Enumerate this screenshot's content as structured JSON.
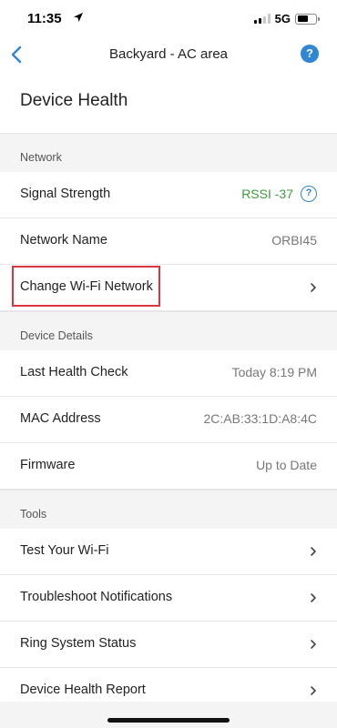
{
  "status_bar": {
    "time": "11:35",
    "network": "5G"
  },
  "nav": {
    "title": "Backyard - AC area",
    "help_glyph": "?"
  },
  "page_title": "Device Health",
  "sections": {
    "network": {
      "header": "Network",
      "signal_strength": {
        "label": "Signal Strength",
        "value": "RSSI -37"
      },
      "network_name": {
        "label": "Network Name",
        "value": "ORBI45"
      },
      "change_wifi": {
        "label": "Change Wi-Fi Network"
      }
    },
    "device_details": {
      "header": "Device Details",
      "last_health_check": {
        "label": "Last Health Check",
        "value": "Today 8:19 PM"
      },
      "mac_address": {
        "label": "MAC Address",
        "value": "2C:AB:33:1D:A8:4C"
      },
      "firmware": {
        "label": "Firmware",
        "value": "Up to Date"
      }
    },
    "tools": {
      "header": "Tools",
      "test_wifi": {
        "label": "Test Your Wi-Fi"
      },
      "troubleshoot_notifications": {
        "label": "Troubleshoot Notifications"
      },
      "ring_system_status": {
        "label": "Ring System Status"
      },
      "device_health_report": {
        "label": "Device Health Report"
      }
    }
  },
  "colors": {
    "accent": "#2f86d4",
    "signal_good": "#3d9a3d",
    "highlight": "#d9363e"
  }
}
